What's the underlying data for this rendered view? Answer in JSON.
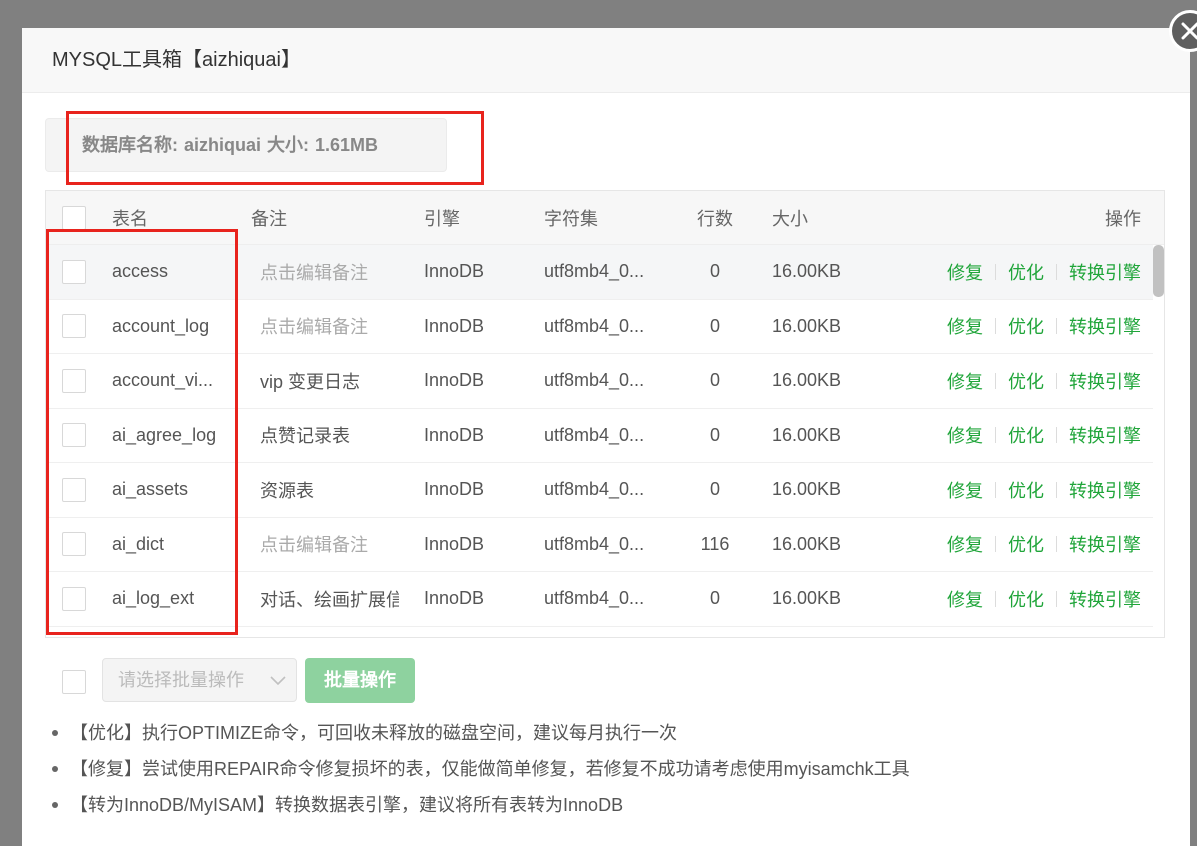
{
  "dialog": {
    "title": "MYSQL工具箱【aizhiquai】",
    "close_icon": "close-icon"
  },
  "db_info": {
    "name_label": "数据库名称:",
    "name": "aizhiquai",
    "size_label": "大小:",
    "size": "1.61MB"
  },
  "table": {
    "columns": {
      "name": "表名",
      "comment": "备注",
      "engine": "引擎",
      "charset": "字符集",
      "rows": "行数",
      "size": "大小",
      "actions": "操作"
    },
    "row_actions": [
      "修复",
      "优化",
      "转换引擎"
    ],
    "rows": [
      {
        "name": "access",
        "comment": "点击编辑备注",
        "comment_is_placeholder": true,
        "engine": "InnoDB",
        "charset": "utf8mb4_0...",
        "rows": 0,
        "size": "16.00KB"
      },
      {
        "name": "account_log",
        "comment": "点击编辑备注",
        "comment_is_placeholder": true,
        "engine": "InnoDB",
        "charset": "utf8mb4_0...",
        "rows": 0,
        "size": "16.00KB"
      },
      {
        "name": "account_vi...",
        "comment": "vip 变更日志",
        "comment_is_placeholder": false,
        "engine": "InnoDB",
        "charset": "utf8mb4_0...",
        "rows": 0,
        "size": "16.00KB"
      },
      {
        "name": "ai_agree_log",
        "comment": "点赞记录表",
        "comment_is_placeholder": false,
        "engine": "InnoDB",
        "charset": "utf8mb4_0...",
        "rows": 0,
        "size": "16.00KB"
      },
      {
        "name": "ai_assets",
        "comment": "资源表",
        "comment_is_placeholder": false,
        "engine": "InnoDB",
        "charset": "utf8mb4_0...",
        "rows": 0,
        "size": "16.00KB"
      },
      {
        "name": "ai_dict",
        "comment": "点击编辑备注",
        "comment_is_placeholder": true,
        "engine": "InnoDB",
        "charset": "utf8mb4_0...",
        "rows": 116,
        "size": "16.00KB"
      },
      {
        "name": "ai_log_ext",
        "comment": "对话、绘画扩展信",
        "comment_is_placeholder": false,
        "engine": "InnoDB",
        "charset": "utf8mb4_0...",
        "rows": 0,
        "size": "16.00KB"
      }
    ]
  },
  "batch": {
    "select_placeholder": "请选择批量操作",
    "select_icon": "chevron-down-icon",
    "button_label": "批量操作",
    "button_disabled": true
  },
  "notes": [
    "【优化】执行OPTIMIZE命令，可回收未释放的磁盘空间，建议每月执行一次",
    "【修复】尝试使用REPAIR命令修复损坏的表，仅能做简单修复，若修复不成功请考虑使用myisamchk工具",
    "【转为InnoDB/MyISAM】转换数据表引擎，建议将所有表转为InnoDB"
  ],
  "colors": {
    "overlay": "#808080",
    "link_green": "#20a53a",
    "button_disabled_green": "#8ed29f",
    "annotation_red": "#e8231d"
  }
}
